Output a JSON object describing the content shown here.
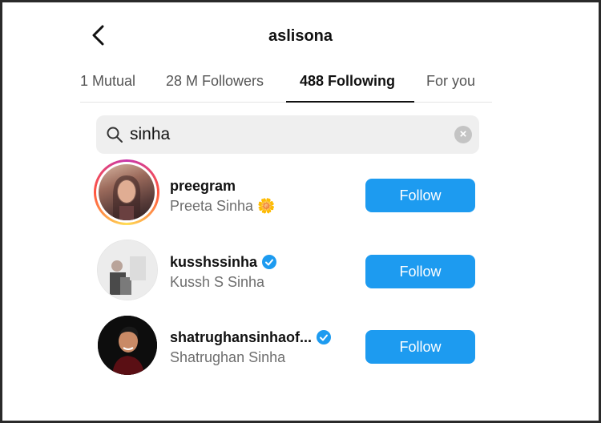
{
  "header": {
    "username": "aslisona"
  },
  "tabs": [
    {
      "label": "1 Mutual"
    },
    {
      "label": "28 M Followers"
    },
    {
      "label": "488 Following",
      "active": true
    },
    {
      "label": "For you"
    }
  ],
  "search": {
    "value": "sinha"
  },
  "colors": {
    "accent": "#1d9bf0",
    "verified": "#1d9bf0"
  },
  "results": [
    {
      "username": "preegram",
      "full_name": "Preeta Sinha",
      "name_emoji": "🌼",
      "verified": false,
      "has_story_ring": true,
      "button_label": "Follow"
    },
    {
      "username": "kusshssinha",
      "full_name": "Kussh S Sinha",
      "verified": true,
      "has_story_ring": false,
      "button_label": "Follow"
    },
    {
      "username": "shatrughansinhaof...",
      "full_name": "Shatrughan Sinha",
      "verified": true,
      "has_story_ring": false,
      "button_label": "Follow"
    }
  ]
}
